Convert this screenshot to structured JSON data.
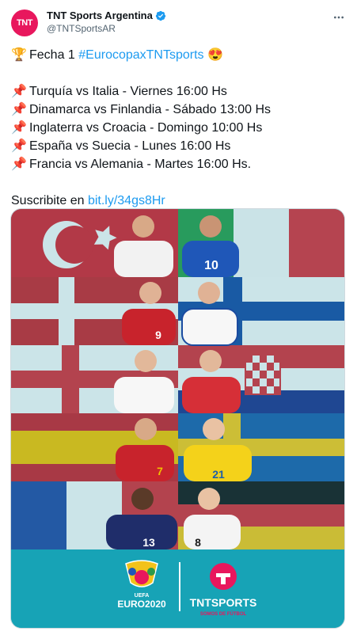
{
  "account": {
    "name": "TNT Sports Argentina",
    "handle": "@TNTSportsAR",
    "avatar_text": "TNT"
  },
  "tweet": {
    "line1": {
      "emoji": "trophy-icon",
      "text": "Fecha 1 ",
      "hashtag": "#EurocopaxTNTsports",
      "trailing_emoji": "heart-eyes-emoji"
    },
    "matches": [
      "Turquía vs Italia - Viernes 16:00 Hs",
      "Dinamarca vs Finlandia - Sábado 13:00 Hs",
      "Inglaterra vs Croacia - Domingo 10:00 Hs",
      "España vs Suecia - Lunes 16:00 Hs",
      "Francia vs Alemania - Martes 16:00 Hs."
    ],
    "subscribe_text": "Suscribite en ",
    "subscribe_link": "bit.ly/34gs8Hr"
  },
  "media": {
    "player_numbers": [
      "10",
      "9",
      "7",
      "21",
      "13",
      "8"
    ],
    "euro_logo_line1": "UEFA",
    "euro_logo_line2": "EURO2020",
    "brand_text": "TNTSPORTS",
    "brand_sub": "SOMOS DE FÚTBOL",
    "colors": {
      "teal": "#17a3b6",
      "pink": "#e8175d"
    }
  }
}
